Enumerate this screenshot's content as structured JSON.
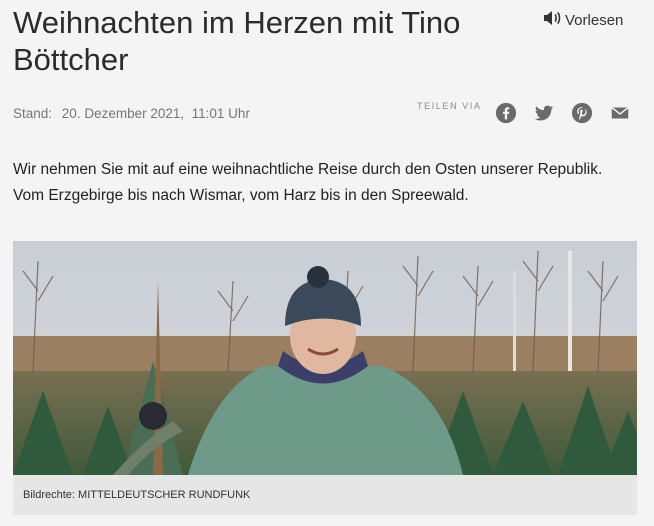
{
  "article": {
    "title": "Weihnachten im Herzen mit Tino Böttcher",
    "stand_label": "Stand:",
    "date": "20. Dezember 2021,  11:01 Uhr",
    "intro": "Wir nehmen Sie mit auf eine weihnachtliche Reise durch den Osten unserer Republik. Vom Erzgebirge bis nach Wismar, vom Harz bis in den Spreewald.",
    "image_caption": "Bildrechte: MITTELDEUTSCHER RUNDFUNK"
  },
  "toolbar": {
    "read_aloud_label": "Vorlesen",
    "read_aloud_icon": "speaker-icon"
  },
  "share": {
    "label": "TEILEN VIA",
    "icons": [
      "facebook-icon",
      "twitter-icon",
      "pinterest-icon",
      "email-icon"
    ]
  },
  "colors": {
    "background": "#f4f4f4",
    "icon_gray": "#6a6a6a",
    "caption_bg": "#e6e6e6"
  }
}
